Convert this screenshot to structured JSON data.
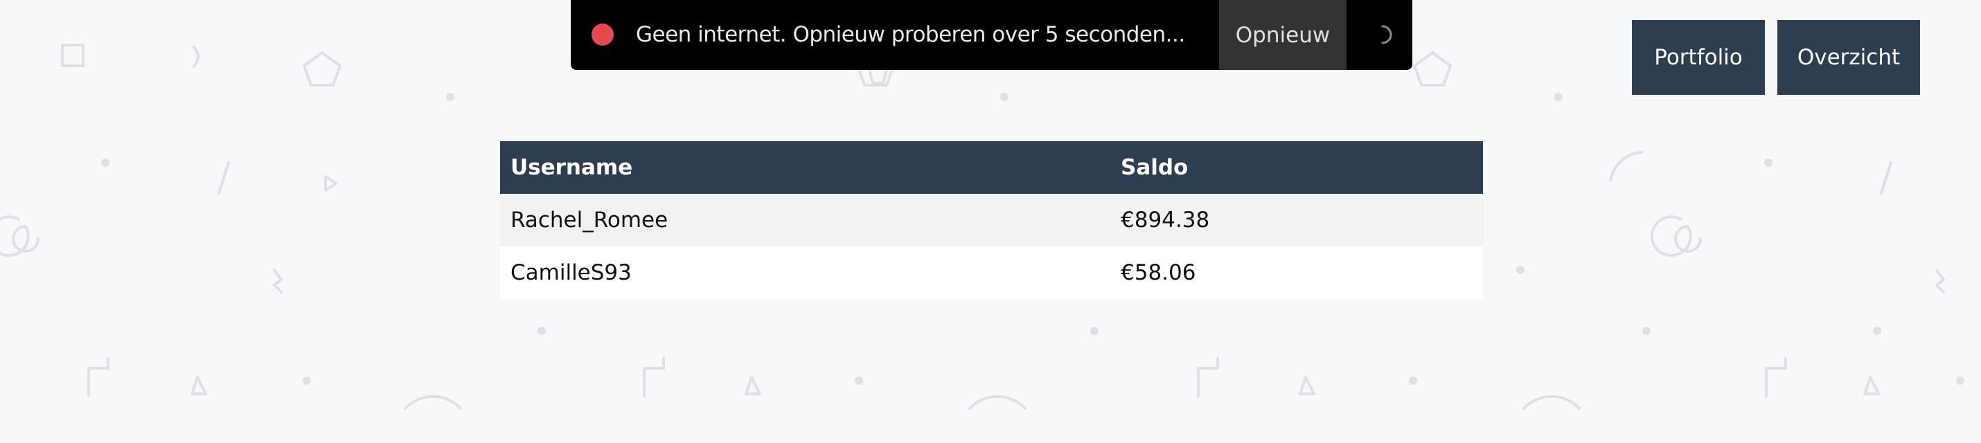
{
  "toast": {
    "message": "Geen internet. Opnieuw proberen over 5 seconden...",
    "retry_label": "Opnieuw",
    "status_color": "#e5484d"
  },
  "nav": {
    "portfolio_label": "Portfolio",
    "overview_label": "Overzicht"
  },
  "table": {
    "headers": [
      "Username",
      "Saldo"
    ],
    "rows": [
      [
        "Rachel_Romee",
        "€894.38"
      ],
      [
        "CamilleS93",
        "€58.06"
      ]
    ]
  },
  "colors": {
    "header_bg": "#2d3e50",
    "page_bg": "#f7f8fa",
    "toast_bg": "#000000"
  }
}
